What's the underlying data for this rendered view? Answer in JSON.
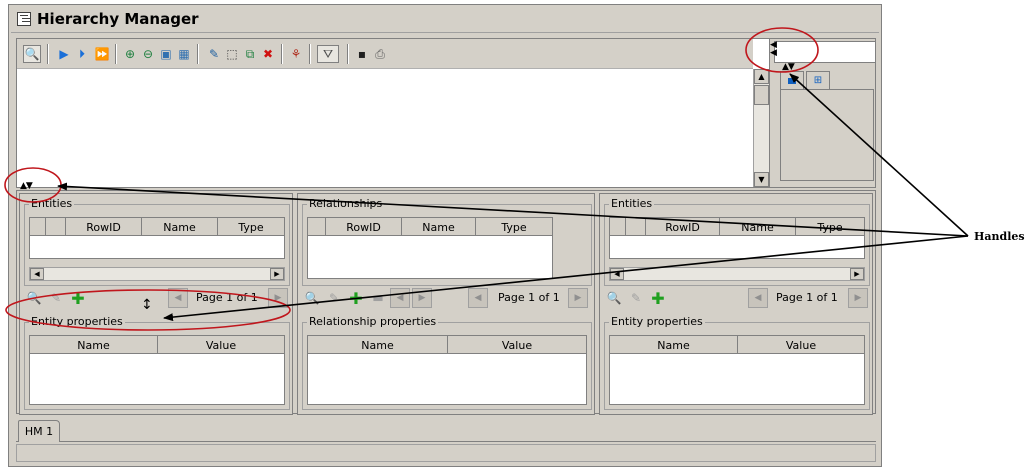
{
  "window": {
    "title": "Hierarchy Manager"
  },
  "toolbar": {
    "buttons": [
      {
        "icon": "find-icon",
        "glyph": "🔍"
      },
      {
        "icon": "play-icon",
        "glyph": "▶"
      },
      {
        "icon": "step-icon",
        "glyph": "⏵"
      },
      {
        "icon": "fast-forward-icon",
        "glyph": "⏩"
      },
      {
        "icon": "zoom-in-icon",
        "glyph": "🔍"
      },
      {
        "icon": "zoom-out-icon",
        "glyph": "🔎"
      },
      {
        "icon": "zoom-fit-icon",
        "glyph": "▣"
      },
      {
        "icon": "zoom-actual-icon",
        "glyph": "▦"
      },
      {
        "icon": "edit-icon",
        "glyph": "✎"
      },
      {
        "icon": "select-icon",
        "glyph": "⬚"
      },
      {
        "icon": "select-all-icon",
        "glyph": "⧉"
      },
      {
        "icon": "delete-icon",
        "glyph": "✖"
      },
      {
        "icon": "hierarchy-icon",
        "glyph": "⚘"
      },
      {
        "icon": "filter-icon",
        "glyph": "⛛"
      },
      {
        "icon": "save-icon",
        "glyph": "▪"
      },
      {
        "icon": "print-icon",
        "glyph": "⎙"
      }
    ]
  },
  "panels": [
    {
      "group_label": "Entities",
      "columns": [
        "",
        "",
        "RowID",
        "Name",
        "Type"
      ],
      "page_label": "Page 1 of 1",
      "properties_label": "Entity properties",
      "properties_columns": [
        "Name",
        "Value"
      ]
    },
    {
      "group_label": "Relationships",
      "columns": [
        "",
        "RowID",
        "Name",
        "Type"
      ],
      "page_label": "Page 1 of 1",
      "properties_label": "Relationship properties",
      "properties_columns": [
        "Name",
        "Value"
      ]
    },
    {
      "group_label": "Entities",
      "columns": [
        "",
        "",
        "RowID",
        "Name",
        "Type"
      ],
      "page_label": "Page 1 of 1",
      "properties_label": "Entity properties",
      "properties_columns": [
        "Name",
        "Value"
      ]
    }
  ],
  "bottom_tabs": [
    {
      "label": "HM 1"
    }
  ],
  "annotation": {
    "label": "Handles",
    "color": "#c0161c"
  }
}
